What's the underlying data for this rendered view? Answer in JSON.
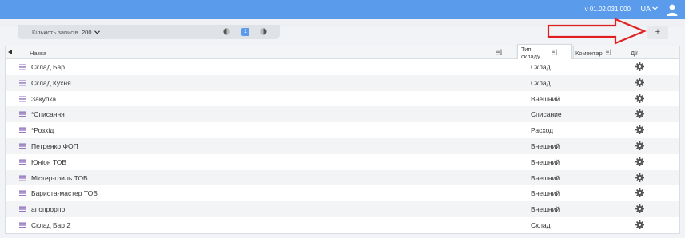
{
  "header": {
    "version": "v 01.02.031.000",
    "language": "UA",
    "chevron_icon": "chevron-down-icon",
    "user_icon": "user-icon"
  },
  "toolbar": {
    "records_label": "Кількість записів",
    "records_value": "200",
    "current_page": "1",
    "add_label": "+"
  },
  "table": {
    "columns": {
      "name": "Назва",
      "type_line1": "Тип",
      "type_line2": "складу",
      "comment": "Коментар",
      "actions": "Дії"
    },
    "rows": [
      {
        "name": "Склад Бар",
        "type": "Склад"
      },
      {
        "name": "Склад Кухня",
        "type": "Склад"
      },
      {
        "name": "Закупка",
        "type": "Внешний"
      },
      {
        "name": "*Списання",
        "type": "Списание"
      },
      {
        "name": "*Розхід",
        "type": "Расход"
      },
      {
        "name": "Петренко ФОП",
        "type": "Внешний"
      },
      {
        "name": "Юніон ТОВ",
        "type": "Внешний"
      },
      {
        "name": "Містер-гриль ТОВ",
        "type": "Внешний"
      },
      {
        "name": "Бариста-мастер ТОВ",
        "type": "Внешний"
      },
      {
        "name": "апопрорпр",
        "type": "Внешний"
      },
      {
        "name": "Склад Бар 2",
        "type": "Склад"
      }
    ]
  },
  "colors": {
    "header_bg": "#5b9bec",
    "arrow": "#e02020",
    "drag_icon": "#8a6bb8"
  }
}
